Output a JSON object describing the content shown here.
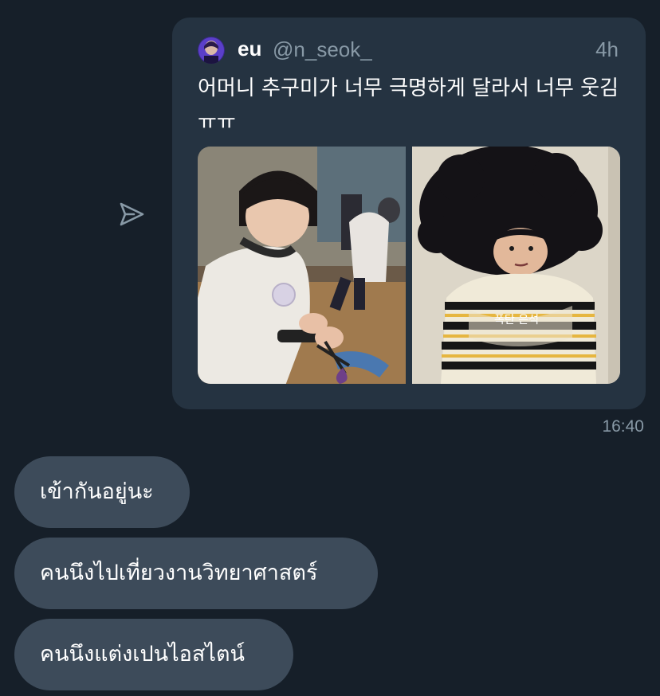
{
  "tweet": {
    "display_name": "eu",
    "handle": "@n_seok_",
    "time_ago": "4h",
    "text": "어머니 추구미가 너무 극명하게 달라서 너무 웃김 ㅠㅠ",
    "media": [
      {
        "description_icon": "photo-child-with-scissors"
      },
      {
        "description_icon": "photo-child-afro-wig",
        "caption": "폭탄 은석"
      }
    ]
  },
  "message_time": "16:40",
  "messages": [
    {
      "text": "เข้ากันอยู่นะ"
    },
    {
      "text": "คนนึงไปเที่ยวงานวิทยาศาสตร์"
    },
    {
      "text": "คนนึงแต่งเปนไอสไตน์"
    }
  ],
  "colors": {
    "background": "#161f29",
    "card": "#253341",
    "bubble": "#3d4b5a",
    "muted_text": "#8899a6"
  },
  "icons": {
    "share": "paper-plane-outline-icon"
  }
}
